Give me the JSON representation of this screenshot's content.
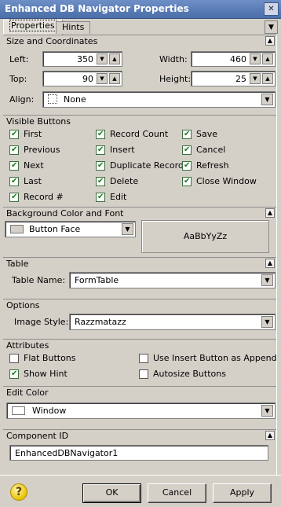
{
  "window": {
    "title": "Enhanced DB Navigator Properties"
  },
  "tabs": [
    {
      "label": "Properties"
    },
    {
      "label": "Hints"
    }
  ],
  "size_coords": {
    "title": "Size and Coordinates",
    "left_label": "Left:",
    "left_value": "350",
    "width_label": "Width:",
    "width_value": "460",
    "top_label": "Top:",
    "top_value": "90",
    "height_label": "Height:",
    "height_value": "25",
    "align_label": "Align:",
    "align_value": "None"
  },
  "visible_buttons": {
    "title": "Visible Buttons",
    "items": [
      {
        "label": "First",
        "checked": true
      },
      {
        "label": "Previous",
        "checked": true
      },
      {
        "label": "Next",
        "checked": true
      },
      {
        "label": "Last",
        "checked": true
      },
      {
        "label": "Record #",
        "checked": true
      },
      {
        "label": "Record Count",
        "checked": true
      },
      {
        "label": "Insert",
        "checked": true
      },
      {
        "label": "Duplicate Record",
        "checked": true
      },
      {
        "label": "Delete",
        "checked": true
      },
      {
        "label": "Edit",
        "checked": true
      },
      {
        "label": "Save",
        "checked": true
      },
      {
        "label": "Cancel",
        "checked": true
      },
      {
        "label": "Refresh",
        "checked": true
      },
      {
        "label": "Close Window",
        "checked": true
      }
    ]
  },
  "background": {
    "title": "Background Color and Font",
    "color_value": "Button Face",
    "swatch_color": "#d4d0c8",
    "font_preview": "AaBbYyZz"
  },
  "table": {
    "title": "Table",
    "label": "Table Name:",
    "value": "FormTable"
  },
  "options": {
    "title": "Options",
    "label": "Image Style:",
    "value": "Razzmatazz"
  },
  "attributes": {
    "title": "Attributes",
    "items": [
      {
        "label": "Flat Buttons",
        "checked": false
      },
      {
        "label": "Show Hint",
        "checked": true
      },
      {
        "label": "Use Insert Button as Append",
        "checked": false
      },
      {
        "label": "Autosize Buttons",
        "checked": false
      }
    ]
  },
  "edit_color": {
    "title": "Edit Color",
    "value": "Window",
    "swatch_color": "#ffffff"
  },
  "component_id": {
    "title": "Component ID",
    "value": "EnhancedDBNavigator1"
  },
  "buttons": {
    "ok": "OK",
    "cancel": "Cancel",
    "apply": "Apply"
  },
  "icons": {
    "help": "?"
  }
}
